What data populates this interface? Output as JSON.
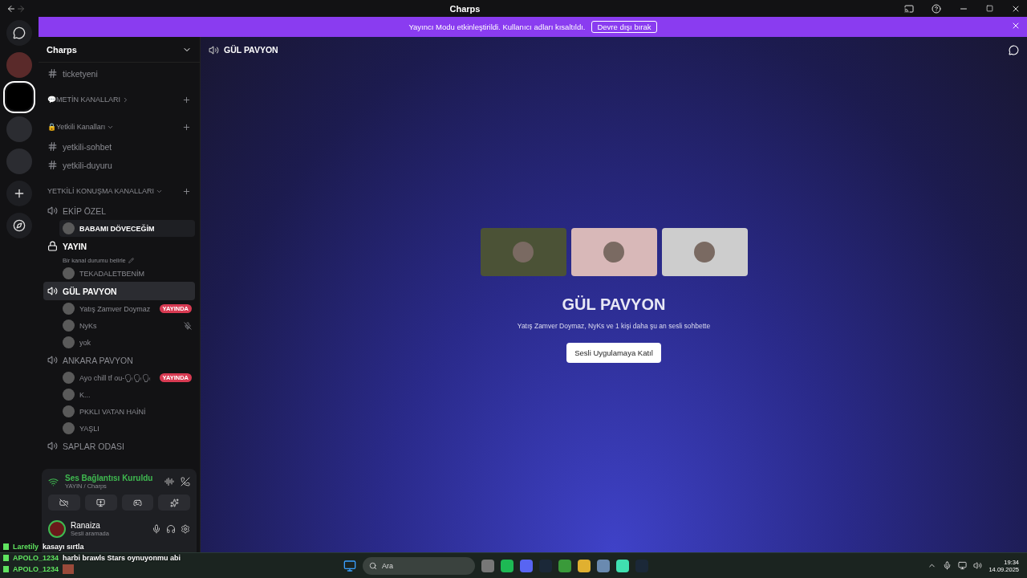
{
  "window": {
    "title": "Charps"
  },
  "banner": {
    "message": "Yayıncı Modu etkinleştirildi. Kullanıcı adları kısaltıldı.",
    "button": "Devre dışı bırak"
  },
  "servers": [
    {
      "kind": "home",
      "selected": false
    },
    {
      "kind": "server",
      "selected": false
    },
    {
      "kind": "server",
      "selected": true
    },
    {
      "kind": "folder",
      "selected": false
    },
    {
      "kind": "folder",
      "selected": false
    },
    {
      "kind": "add",
      "selected": false
    },
    {
      "kind": "discover",
      "selected": false
    }
  ],
  "sidebar": {
    "server_name": "Charps",
    "channels": [
      {
        "kind": "text",
        "name": "ticketyeni",
        "selected": false
      },
      {
        "kind": "category",
        "name": "💬METİN KANALLARI",
        "expanded": false
      },
      {
        "kind": "category",
        "name": "🔒Yetkili Kanalları",
        "expanded": true
      },
      {
        "kind": "text",
        "name": "yetkili-sohbet",
        "selected": false
      },
      {
        "kind": "text",
        "name": "yetkili-duyuru",
        "selected": false
      },
      {
        "kind": "category",
        "name": "YETKİLİ KONUŞMA KANALLARI",
        "expanded": true
      },
      {
        "kind": "voice",
        "name": "EKİP ÖZEL",
        "selected": false,
        "locked": false,
        "members": [
          {
            "name": "BABAMI DÖVECEĞİM",
            "live": false,
            "muted": false,
            "hovered": true
          }
        ]
      },
      {
        "kind": "voice",
        "name": "YAYIN",
        "selected": false,
        "locked": true,
        "status": "Bir kanal durumu belirle",
        "members": [
          {
            "name": "TEKADALETBENİM",
            "live": false,
            "muted": false,
            "hovered": false
          }
        ]
      },
      {
        "kind": "voice",
        "name": "GÜL PAVYON",
        "selected": true,
        "locked": false,
        "members": [
          {
            "name": "Yatış Zamver Doymaz",
            "live": true,
            "live_label": "YAYINDA",
            "muted": false,
            "hovered": false
          },
          {
            "name": "NyKs",
            "live": false,
            "muted": true,
            "hovered": false
          },
          {
            "name": "yok",
            "live": false,
            "muted": false,
            "hovered": false
          }
        ]
      },
      {
        "kind": "voice",
        "name": "ANKARA PAVYON",
        "selected": false,
        "locked": false,
        "members": [
          {
            "name": "Ayo chill tf ou-🗣🗣🗣",
            "live": true,
            "live_label": "YAYINDA",
            "muted": false,
            "hovered": false
          },
          {
            "name": "K...",
            "live": false,
            "muted": false,
            "hovered": false
          },
          {
            "name": "PKKLI VATAN HAİNİ",
            "live": false,
            "muted": false,
            "hovered": false
          },
          {
            "name": "YAŞLI",
            "live": false,
            "muted": false,
            "hovered": false
          }
        ]
      },
      {
        "kind": "voice",
        "name": "SAPLAR ODASI",
        "selected": false,
        "locked": false
      }
    ]
  },
  "voice_panel": {
    "status": "Ses Bağlantısı Kuruldu",
    "channel": "YAYIN / Charps"
  },
  "user": {
    "name": "Ranaiza",
    "status": "Sesli aramada"
  },
  "main": {
    "channel": "GÜL PAVYON",
    "tiles": [
      {
        "color": "#4b5236"
      },
      {
        "color": "#d8b8b8"
      },
      {
        "color": "#cdcdcd"
      }
    ],
    "title": "GÜL PAVYON",
    "subtitle": "Yatış Zamver Doymaz, NyKs ve 1 kişi daha şu an sesli sohbette",
    "button": "Sesli Uygulamaya Katıl"
  },
  "chat_overlay": [
    {
      "user": "Laretily",
      "text": "kasayı sırtla",
      "image": false
    },
    {
      "user": "APOLO_1234",
      "text": "harbi brawls Stars oynuyonmu abi",
      "image": false
    },
    {
      "user": "APOLO_1234",
      "image": true
    }
  ],
  "taskbar": {
    "search": "Ara",
    "time": "19:34",
    "date": "14.09.2025"
  }
}
